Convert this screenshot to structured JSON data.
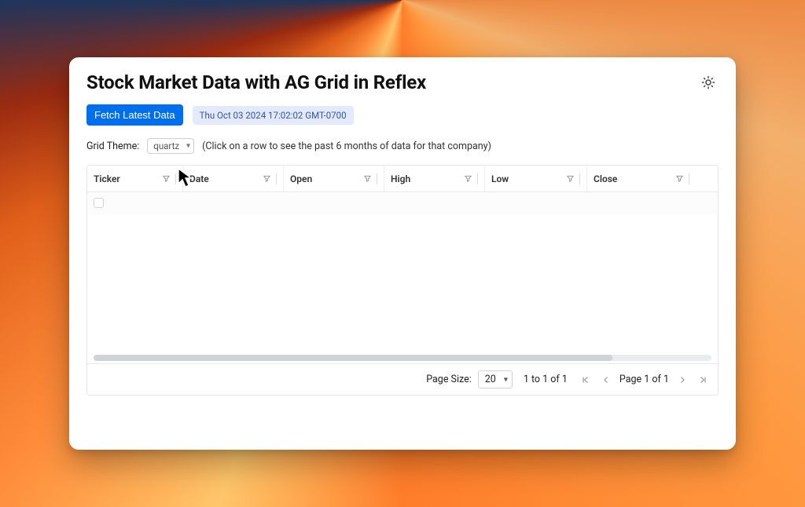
{
  "header": {
    "title": "Stock Market Data with AG Grid in Reflex"
  },
  "toolbar": {
    "fetch_label": "Fetch Latest Data",
    "timestamp": "Thu Oct 03 2024 17:02:02 GMT-0700"
  },
  "theme": {
    "label": "Grid Theme:",
    "selected": "quartz",
    "hint": "(Click on a row to see the past 6 months of data for that company)"
  },
  "grid": {
    "columns": [
      "Ticker",
      "Date",
      "Open",
      "High",
      "Low",
      "Close"
    ],
    "rows": []
  },
  "pagination": {
    "page_size_label": "Page Size:",
    "page_size_value": "20",
    "range_text": "1 to 1 of 1",
    "page_text": "Page 1 of 1"
  }
}
